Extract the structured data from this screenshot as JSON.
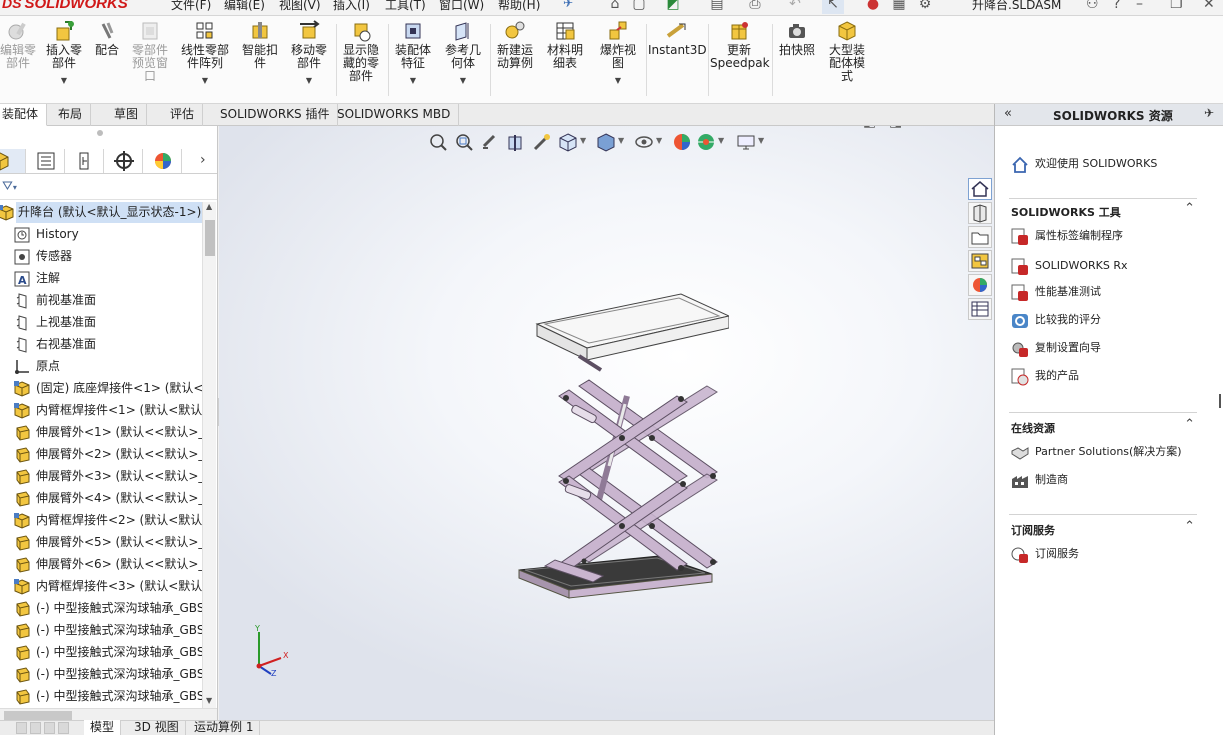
{
  "app": {
    "brand": "SOLIDWORKS",
    "brand_mark": "DS",
    "document_title": "升降台.SLDASM"
  },
  "menu": [
    "文件(F)",
    "编辑(E)",
    "视图(V)",
    "插入(I)",
    "工具(T)",
    "窗口(W)",
    "帮助(H)"
  ],
  "ribbon": [
    {
      "label": "编辑零\n部件",
      "icon": "edit-component-icon",
      "enabled": false,
      "dropdown": false
    },
    {
      "label": "插入零\n部件",
      "icon": "insert-component-icon",
      "enabled": true,
      "dropdown": true
    },
    {
      "label": "配合",
      "icon": "mate-icon",
      "enabled": true,
      "dropdown": false
    },
    {
      "label": "零部件\n预览窗\n口",
      "icon": "component-preview-icon",
      "enabled": false,
      "dropdown": false
    },
    {
      "label": "线性零部\n件阵列",
      "icon": "linear-pattern-icon",
      "enabled": true,
      "dropdown": true
    },
    {
      "label": "智能扣\n件",
      "icon": "smart-fasteners-icon",
      "enabled": true,
      "dropdown": false
    },
    {
      "label": "移动零\n部件",
      "icon": "move-component-icon",
      "enabled": true,
      "dropdown": true
    },
    {
      "label": "显示隐\n藏的零\n部件",
      "icon": "show-hidden-icon",
      "enabled": true,
      "dropdown": false
    },
    {
      "label": "装配体\n特征",
      "icon": "assembly-feature-icon",
      "enabled": true,
      "dropdown": true
    },
    {
      "label": "参考几\n何体",
      "icon": "reference-geometry-icon",
      "enabled": true,
      "dropdown": true
    },
    {
      "label": "新建运\n动算例",
      "icon": "new-motion-study-icon",
      "enabled": true,
      "dropdown": false
    },
    {
      "label": "材料明\n细表",
      "icon": "bom-icon",
      "enabled": true,
      "dropdown": false
    },
    {
      "label": "爆炸视\n图",
      "icon": "exploded-view-icon",
      "enabled": true,
      "dropdown": true
    },
    {
      "label": "Instant3D",
      "icon": "instant3d-icon",
      "enabled": true,
      "dropdown": false
    },
    {
      "label": "更新\nSpeedpak",
      "icon": "speedpak-icon",
      "enabled": true,
      "dropdown": false
    },
    {
      "label": "拍快照",
      "icon": "snapshot-icon",
      "enabled": true,
      "dropdown": false
    },
    {
      "label": "大型装\n配体模\n式",
      "icon": "large-assembly-icon",
      "enabled": true,
      "dropdown": false
    }
  ],
  "command_tabs": [
    "装配体",
    "布局",
    "草图",
    "评估",
    "SOLIDWORKS 插件",
    "SOLIDWORKS MBD"
  ],
  "active_command_tab": "装配体",
  "feature_tree": [
    {
      "label": "升降台  (默认<默认_显示状态-1>)",
      "icon": "assembly-icon",
      "root": true
    },
    {
      "label": "History",
      "icon": "history-icon"
    },
    {
      "label": "传感器",
      "icon": "sensor-icon"
    },
    {
      "label": "注解",
      "icon": "annotation-icon"
    },
    {
      "label": "前视基准面",
      "icon": "plane-icon"
    },
    {
      "label": "上视基准面",
      "icon": "plane-icon"
    },
    {
      "label": "右视基准面",
      "icon": "plane-icon"
    },
    {
      "label": "原点",
      "icon": "origin-icon"
    },
    {
      "label": "(固定) 底座焊接件<1> (默认<默",
      "icon": "subassembly-icon"
    },
    {
      "label": "内臂框焊接件<1> (默认<默认_",
      "icon": "subassembly-icon"
    },
    {
      "label": "伸展臂外<1> (默认<<默认>_5",
      "icon": "part-icon"
    },
    {
      "label": "伸展臂外<2> (默认<<默认>_5",
      "icon": "part-icon"
    },
    {
      "label": "伸展臂外<3> (默认<<默认>_5",
      "icon": "part-icon"
    },
    {
      "label": "伸展臂外<4> (默认<<默认>_5",
      "icon": "part-icon"
    },
    {
      "label": "内臂框焊接件<2> (默认<默认_",
      "icon": "subassembly-icon"
    },
    {
      "label": "伸展臂外<5> (默认<<默认>_5",
      "icon": "part-icon"
    },
    {
      "label": "伸展臂外<6> (默认<<默认>_5",
      "icon": "part-icon"
    },
    {
      "label": "内臂框焊接件<3> (默认<默认_",
      "icon": "subassembly-icon"
    },
    {
      "label": "(-) 中型接触式深沟球轴承_GBS",
      "icon": "part-icon"
    },
    {
      "label": "(-) 中型接触式深沟球轴承_GBS",
      "icon": "part-icon"
    },
    {
      "label": "(-) 中型接触式深沟球轴承_GBS",
      "icon": "part-icon"
    },
    {
      "label": "(-) 中型接触式深沟球轴承_GBS",
      "icon": "part-icon"
    },
    {
      "label": "(-) 中型接触式深沟球轴承_GBS",
      "icon": "part-icon"
    }
  ],
  "bottom_tabs": [
    "模型",
    "3D 视图",
    "运动算例 1"
  ],
  "active_bottom_tab": "模型",
  "task_pane": {
    "title": "SOLIDWORKS 资源",
    "welcome": "欢迎使用  SOLIDWORKS",
    "sections": [
      {
        "title": "SOLIDWORKS 工具",
        "items": [
          {
            "label": "属性标签编制程序",
            "icon": "property-tab-builder-icon"
          },
          {
            "label": "SOLIDWORKS Rx",
            "icon": "solidworks-rx-icon"
          },
          {
            "label": "性能基准测试",
            "icon": "performance-benchmark-icon"
          },
          {
            "label": "比较我的评分",
            "icon": "compare-score-icon"
          },
          {
            "label": "复制设置向导",
            "icon": "copy-settings-icon"
          },
          {
            "label": "我的产品",
            "icon": "my-products-icon"
          }
        ]
      },
      {
        "title": "在线资源",
        "items": [
          {
            "label": "Partner Solutions(解决方案)",
            "icon": "partner-solutions-icon"
          },
          {
            "label": "制造商",
            "icon": "manufacturers-icon"
          }
        ]
      },
      {
        "title": "订阅服务",
        "items": [
          {
            "label": "订阅服务",
            "icon": "subscription-icon"
          }
        ]
      }
    ]
  },
  "colors": {
    "brand_red": "#d01818",
    "arm_lilac": "#c9b5cf",
    "arm_lilac_dark": "#8f7a96",
    "platform_base": "#3a3a3a",
    "tree_selected": "#cfe0f5"
  }
}
